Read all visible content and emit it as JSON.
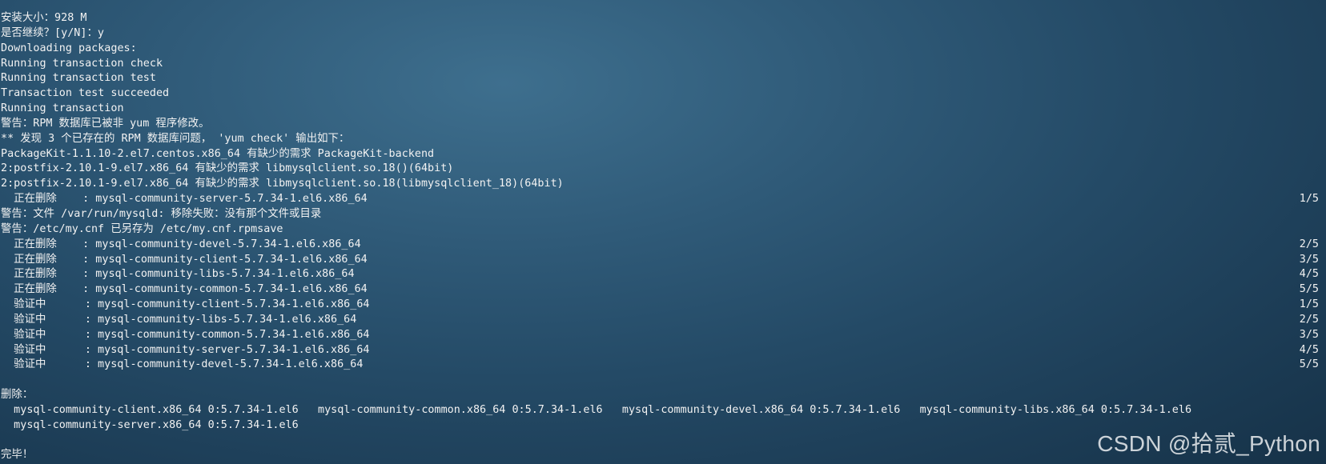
{
  "terminal": {
    "lines": [
      {
        "text": "安装大小：928 M"
      },
      {
        "text": "是否继续？[y/N]：y"
      },
      {
        "text": "Downloading packages:"
      },
      {
        "text": "Running transaction check"
      },
      {
        "text": "Running transaction test"
      },
      {
        "text": "Transaction test succeeded"
      },
      {
        "text": "Running transaction"
      },
      {
        "text": "警告：RPM 数据库已被非 yum 程序修改。"
      },
      {
        "text": "** 发现 3 个已存在的 RPM 数据库问题， 'yum check' 输出如下："
      },
      {
        "text": "PackageKit-1.1.10-2.el7.centos.x86_64 有缺少的需求 PackageKit-backend"
      },
      {
        "text": "2:postfix-2.10.1-9.el7.x86_64 有缺少的需求 libmysqlclient.so.18()(64bit)"
      },
      {
        "text": "2:postfix-2.10.1-9.el7.x86_64 有缺少的需求 libmysqlclient.so.18(libmysqlclient_18)(64bit)"
      },
      {
        "text": "  正在删除    : mysql-community-server-5.7.34-1.el6.x86_64",
        "progress": "1/5"
      },
      {
        "text": "警告：文件 /var/run/mysqld: 移除失败：没有那个文件或目录"
      },
      {
        "text": "警告：/etc/my.cnf 已另存为 /etc/my.cnf.rpmsave"
      },
      {
        "text": "  正在删除    : mysql-community-devel-5.7.34-1.el6.x86_64",
        "progress": "2/5"
      },
      {
        "text": "  正在删除    : mysql-community-client-5.7.34-1.el6.x86_64",
        "progress": "3/5"
      },
      {
        "text": "  正在删除    : mysql-community-libs-5.7.34-1.el6.x86_64",
        "progress": "4/5"
      },
      {
        "text": "  正在删除    : mysql-community-common-5.7.34-1.el6.x86_64",
        "progress": "5/5"
      },
      {
        "text": "  验证中      : mysql-community-client-5.7.34-1.el6.x86_64",
        "progress": "1/5"
      },
      {
        "text": "  验证中      : mysql-community-libs-5.7.34-1.el6.x86_64",
        "progress": "2/5"
      },
      {
        "text": "  验证中      : mysql-community-common-5.7.34-1.el6.x86_64",
        "progress": "3/5"
      },
      {
        "text": "  验证中      : mysql-community-server-5.7.34-1.el6.x86_64",
        "progress": "4/5"
      },
      {
        "text": "  验证中      : mysql-community-devel-5.7.34-1.el6.x86_64",
        "progress": "5/5"
      },
      {
        "text": ""
      },
      {
        "text": "删除："
      },
      {
        "text": "  mysql-community-client.x86_64 0:5.7.34-1.el6   mysql-community-common.x86_64 0:5.7.34-1.el6   mysql-community-devel.x86_64 0:5.7.34-1.el6   mysql-community-libs.x86_64 0:5.7.34-1.el6"
      },
      {
        "text": "  mysql-community-server.x86_64 0:5.7.34-1.el6"
      },
      {
        "text": ""
      },
      {
        "text": "完毕！"
      }
    ]
  },
  "watermark": {
    "text": "CSDN @拾贰_Python"
  },
  "colors": {
    "text": "#f2f2f2",
    "background": "#2a5270"
  }
}
